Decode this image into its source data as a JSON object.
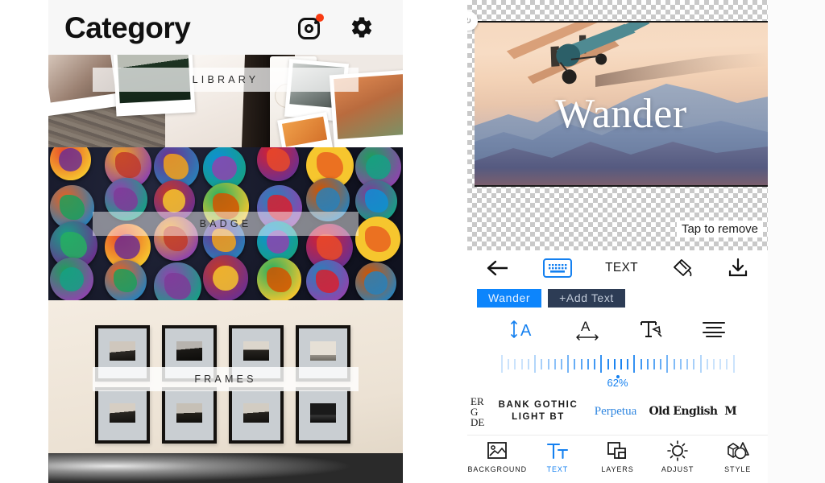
{
  "left": {
    "header": {
      "title": "Category",
      "instagram_icon": "instagram-icon",
      "instagram_badge": "notification-dot",
      "settings_icon": "gear-icon"
    },
    "categories": [
      {
        "label": "LIBRARY",
        "name": "category-library"
      },
      {
        "label": "BADGE",
        "name": "category-badge"
      },
      {
        "label": "FRAMES",
        "name": "category-frames"
      }
    ]
  },
  "right": {
    "canvas": {
      "handle_icon": "rotate-handle-icon",
      "overlay_text": "Wander",
      "hint": "Tap to remove"
    },
    "toolbar": {
      "back_icon": "back-arrow-icon",
      "keyboard_icon": "keyboard-icon",
      "text_label": "TEXT",
      "color_icon": "color-picker-icon",
      "download_icon": "download-icon"
    },
    "chips": [
      {
        "label": "Wander",
        "name": "text-layer-chip-wander",
        "selected": true
      },
      {
        "label": "+Add  Text",
        "name": "add-text-chip",
        "selected": false
      }
    ],
    "format_icons": [
      {
        "name": "font-size-icon",
        "active": true
      },
      {
        "name": "letter-spacing-icon",
        "active": false
      },
      {
        "name": "text-style-icon",
        "active": false
      },
      {
        "name": "text-align-icon",
        "active": false
      }
    ],
    "slider": {
      "value_label": "62%",
      "value": 62,
      "accent": "#1480f0"
    },
    "fonts": [
      {
        "label": "ER\nG\nDE",
        "name": "font-option-partial-left",
        "selected": false
      },
      {
        "label": "BANK GOTHIC\nLIGHT BT",
        "name": "font-option-bank-gothic",
        "selected": false
      },
      {
        "label": "Perpetua",
        "name": "font-option-perpetua",
        "selected": true
      },
      {
        "label": "Old English",
        "name": "font-option-old-english",
        "selected": false
      },
      {
        "label": "M",
        "name": "font-option-partial-right",
        "selected": false
      }
    ],
    "bottom_nav": [
      {
        "label": "BACKGROUND",
        "icon": "image-icon",
        "name": "nav-background",
        "active": false
      },
      {
        "label": "TEXT",
        "icon": "text-tt-icon",
        "name": "nav-text",
        "active": true
      },
      {
        "label": "LAYERS",
        "icon": "layers-icon",
        "name": "nav-layers",
        "active": false
      },
      {
        "label": "ADJUST",
        "icon": "sun-icon",
        "name": "nav-adjust",
        "active": false
      },
      {
        "label": "STYLE",
        "icon": "shapes-icon",
        "name": "nav-style",
        "active": false
      }
    ]
  },
  "colors": {
    "accent_blue": "#1480f0",
    "chip_blue": "#0d85fc",
    "chip_dark": "#2d3c55",
    "notification_red": "#f93b12"
  }
}
